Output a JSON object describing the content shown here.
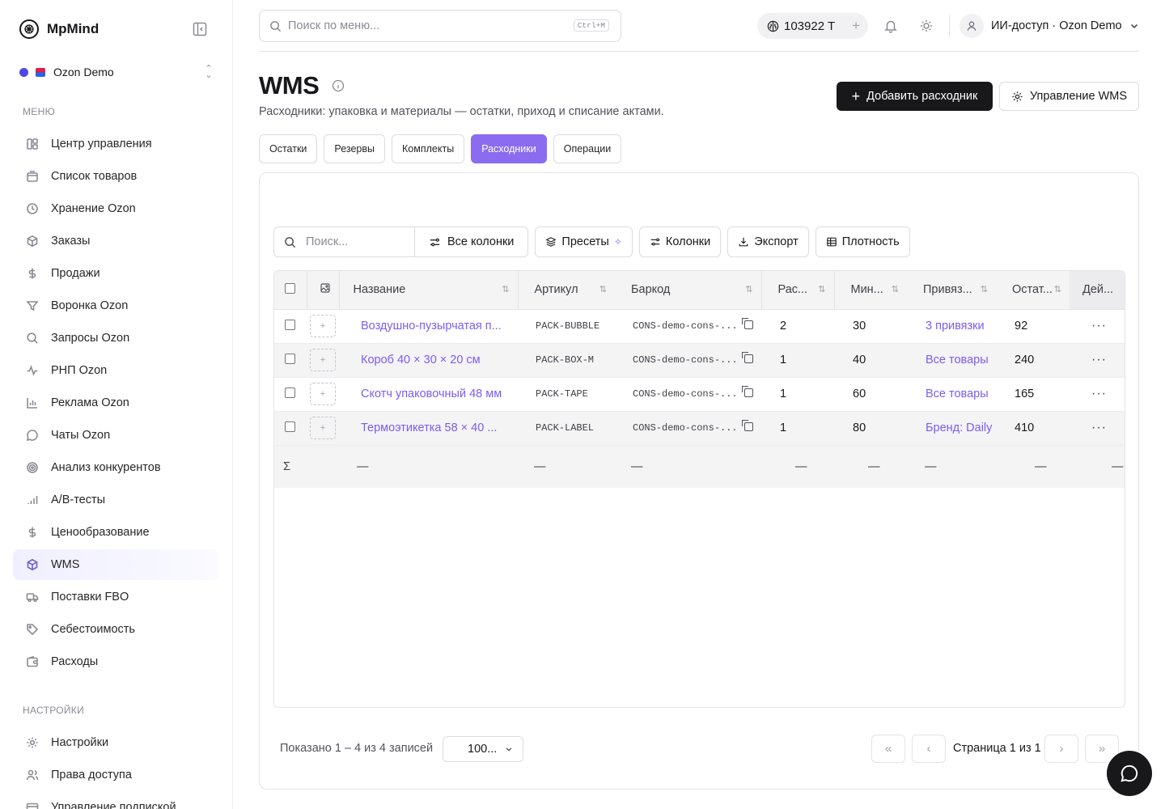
{
  "brand": {
    "name": "MpMind"
  },
  "workspace": {
    "name": "Ozon Demo"
  },
  "sidebar": {
    "menu_label": "МЕНЮ",
    "settings_label": "НАСТРОЙКИ",
    "items": [
      {
        "label": "Центр управления",
        "icon": "dashboard-icon"
      },
      {
        "label": "Список товаров",
        "icon": "box-icon"
      },
      {
        "label": "Хранение Ozon",
        "icon": "clock-icon"
      },
      {
        "label": "Заказы",
        "icon": "package-icon"
      },
      {
        "label": "Продажи",
        "icon": "dollar-icon"
      },
      {
        "label": "Воронка Ozon",
        "icon": "funnel-icon"
      },
      {
        "label": "Запросы Ozon",
        "icon": "search-icon"
      },
      {
        "label": "РНП Ozon",
        "icon": "activity-icon"
      },
      {
        "label": "Реклама Ozon",
        "icon": "bar-chart-icon"
      },
      {
        "label": "Чаты Ozon",
        "icon": "chat-icon"
      },
      {
        "label": "Анализ конкурентов",
        "icon": "target-icon"
      },
      {
        "label": "A/B-тесты",
        "icon": "signal-icon"
      },
      {
        "label": "Ценообразование",
        "icon": "dollar-icon"
      },
      {
        "label": "WMS",
        "icon": "package-icon",
        "active": true
      },
      {
        "label": "Поставки FBO",
        "icon": "truck-icon"
      },
      {
        "label": "Себестоимость",
        "icon": "tag-icon"
      },
      {
        "label": "Расходы",
        "icon": "wallet-icon"
      }
    ],
    "settings_items": [
      {
        "label": "Настройки",
        "icon": "gear-icon"
      },
      {
        "label": "Права доступа",
        "icon": "users-icon"
      },
      {
        "label": "Управление подпиской",
        "icon": "card-icon"
      }
    ]
  },
  "topbar": {
    "search_placeholder": "Поиск по меню...",
    "search_shortcut": "Ctrl+M",
    "balance": "103922 T",
    "user": "ИИ-доступ · Ozon Demo"
  },
  "page": {
    "title": "WMS",
    "subtitle": "Расходники: упаковка и материалы — остатки, приход и списание актами.",
    "add_button": "Добавить расходник",
    "manage_button": "Управление WMS",
    "tabs": [
      "Остатки",
      "Резервы",
      "Комплекты",
      "Расходники",
      "Операции"
    ],
    "active_tab": "Расходники"
  },
  "toolbar": {
    "search_placeholder": "Поиск...",
    "all_columns": "Все колонки",
    "presets": "Пресеты",
    "columns": "Колонки",
    "export": "Экспорт",
    "density": "Плотность"
  },
  "table": {
    "headers": [
      "Название",
      "Артикул",
      "Баркод",
      "Рас...",
      "Мин...",
      "Привяз...",
      "Остат...",
      "Дей..."
    ],
    "rows": [
      {
        "name": "Воздушно-пузырчатая п...",
        "sku": "PACK-BUBBLE",
        "barcode": "CONS-demo-cons-...",
        "usage": "2",
        "min": "30",
        "binding": "3 привязки",
        "stock": "92"
      },
      {
        "name": "Короб 40 × 30 × 20 см",
        "sku": "PACK-BOX-M",
        "barcode": "CONS-demo-cons-...",
        "usage": "1",
        "min": "40",
        "binding": "Все товары",
        "stock": "240"
      },
      {
        "name": "Скотч упаковочный 48 мм",
        "sku": "PACK-TAPE",
        "barcode": "CONS-demo-cons-...",
        "usage": "1",
        "min": "60",
        "binding": "Все товары",
        "stock": "165"
      },
      {
        "name": "Термоэтикетка 58 × 40 ...",
        "sku": "PACK-LABEL",
        "barcode": "CONS-demo-cons-...",
        "usage": "1",
        "min": "80",
        "binding": "Бренд: Daily",
        "stock": "410"
      }
    ],
    "sum_symbol": "Σ",
    "dash": "—"
  },
  "footer": {
    "shown": "Показано 1 – 4 из 4 записей",
    "page_size": "100...",
    "page_info": "Страница 1 из 1"
  }
}
